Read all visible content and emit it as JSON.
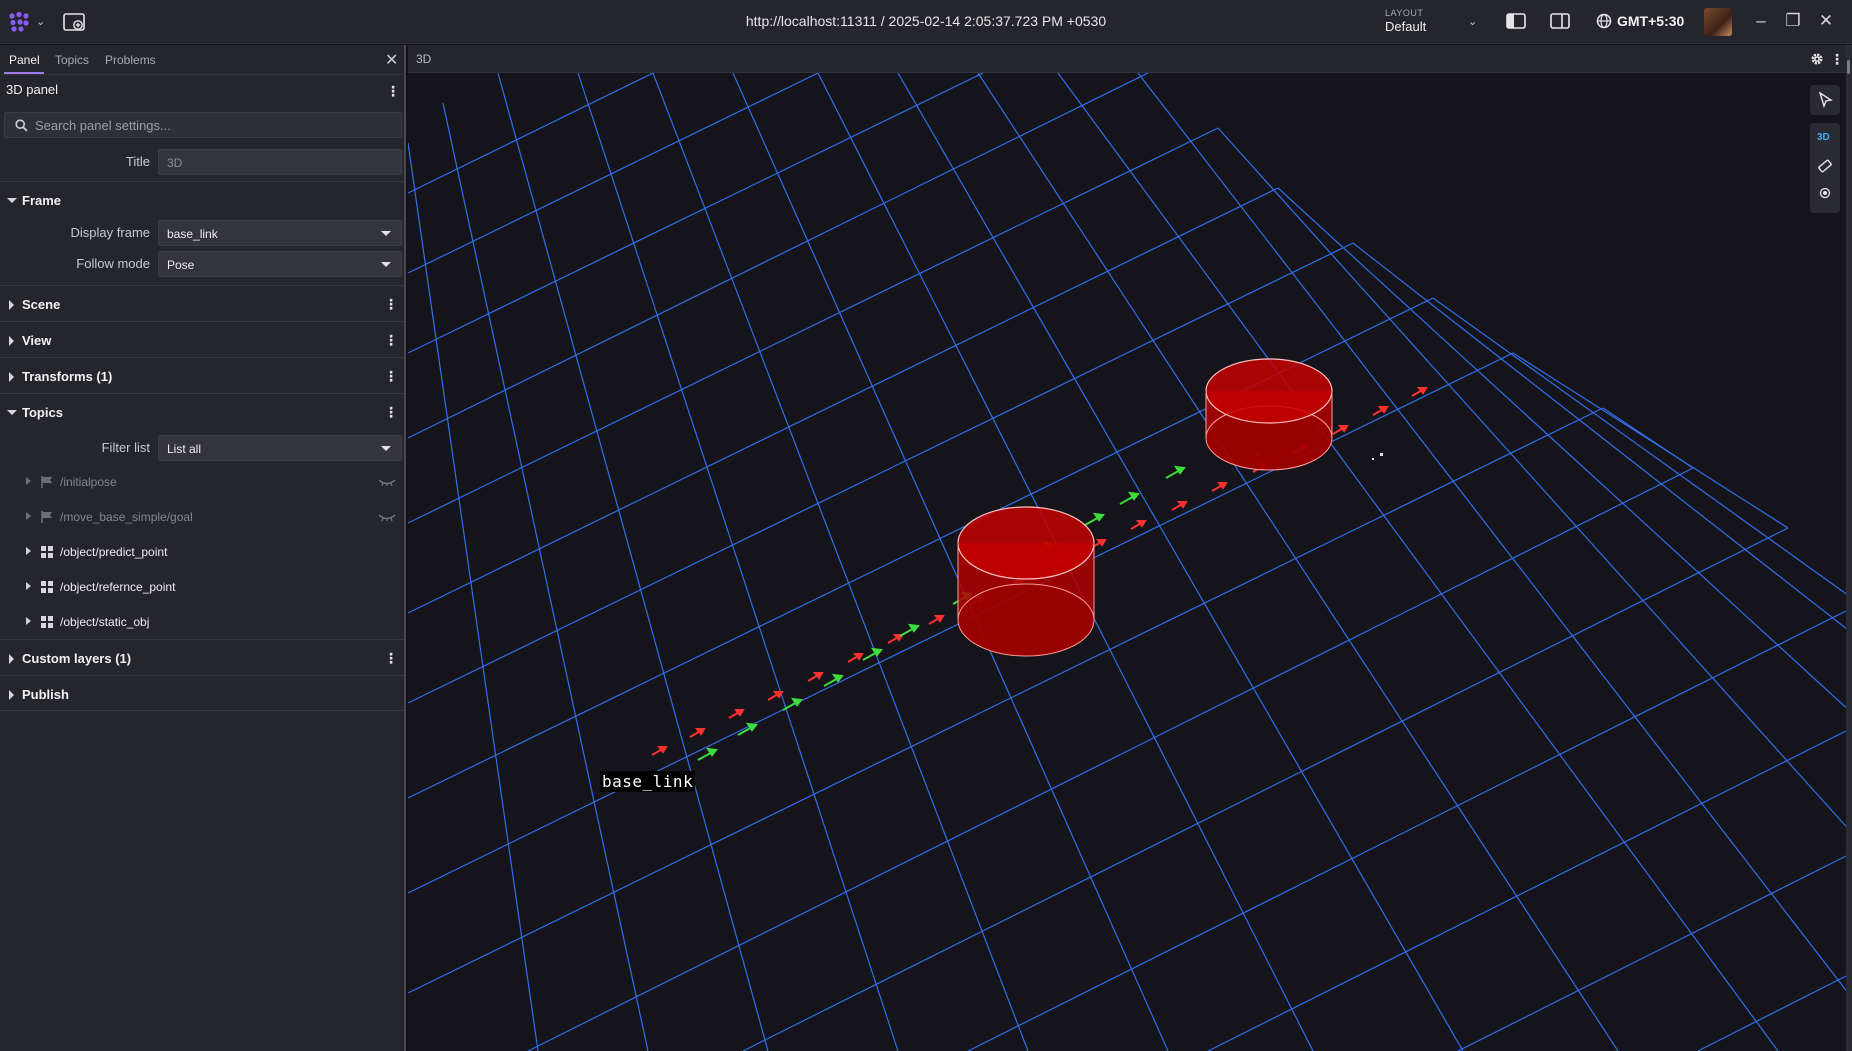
{
  "window": {
    "title": "http://localhost:11311 / 2025-02-14 2:05:37.723 PM +0530",
    "layout_label": "LAYOUT",
    "layout_value": "Default",
    "timezone": "GMT+5:30"
  },
  "sidebar": {
    "tabs": [
      "Panel",
      "Topics",
      "Problems"
    ],
    "panel_title": "3D panel",
    "search_placeholder": "Search panel settings...",
    "title_label": "Title",
    "title_value": "3D",
    "sections": {
      "frame": "Frame",
      "scene": "Scene",
      "view": "View",
      "transforms": "Transforms (1)",
      "topics": "Topics",
      "custom_layers": "Custom layers (1)",
      "publish": "Publish"
    },
    "display_frame_label": "Display frame",
    "display_frame_value": "base_link",
    "follow_mode_label": "Follow mode",
    "follow_mode_value": "Pose",
    "filter_list_label": "Filter list",
    "filter_list_value": "List all",
    "topics": [
      {
        "name": "/initialpose",
        "icon": "flag-icon",
        "visible": false
      },
      {
        "name": "/move_base_simple/goal",
        "icon": "flag-icon",
        "visible": false
      },
      {
        "name": "/object/predict_point",
        "icon": "grid-icon",
        "visible": true
      },
      {
        "name": "/object/refernce_point",
        "icon": "grid-icon",
        "visible": true
      },
      {
        "name": "/object/static_obj",
        "icon": "grid-icon",
        "visible": true
      }
    ]
  },
  "viewport": {
    "panel_title": "3D",
    "mode_label": "3D",
    "frame_label": "base_link",
    "colors": {
      "grid": "#2f6fe8",
      "cylinder": "#b00000",
      "green_arrow": "#3ddc3d",
      "red_arrow": "#ff3030",
      "background": "#15141a"
    }
  }
}
